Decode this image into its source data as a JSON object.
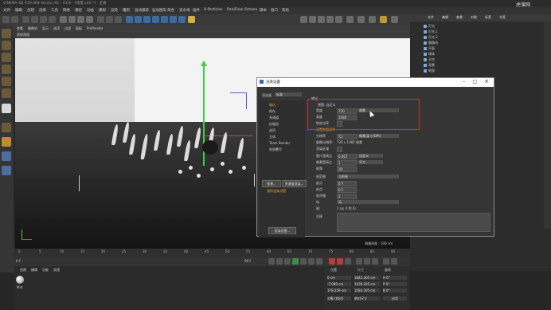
{
  "window": {
    "title": "CINEMA 4D R19.068 Studio (RC - R19) - [场景.c4d *] - 主要",
    "logo": "虎课网"
  },
  "menubar": [
    "文件",
    "编辑",
    "创建",
    "选择",
    "工具",
    "网格",
    "捕捉",
    "动画",
    "模拟",
    "渲染",
    "雕刻",
    "运动跟踪",
    "运动图形",
    "角色",
    "流水线",
    "插件",
    "X-Particles",
    "RealFlow",
    "Octane",
    "脚本",
    "窗口",
    "帮助"
  ],
  "viewport": {
    "menu": [
      "查看",
      "摄像机",
      "显示",
      "选项",
      "过滤",
      "面板",
      "ProRender"
    ],
    "label": "透视视图",
    "grid_spacing": "网格间距 : 100 cm"
  },
  "right_panel": {
    "tabs": [
      "文件",
      "编辑",
      "查看",
      "对象",
      "标签",
      "书签"
    ],
    "objects": [
      "灯光",
      "灯光.1",
      "灯光.2",
      "摄像机",
      "平面",
      "球体",
      "天空",
      "背景",
      "地面"
    ]
  },
  "timeline": {
    "ticks": [
      "0",
      "5",
      "10",
      "15",
      "20",
      "25",
      "30",
      "35",
      "40",
      "45",
      "50",
      "55",
      "60",
      "65",
      "70",
      "75",
      "80",
      "85",
      "90"
    ],
    "frame": "0 F",
    "end": "90 F"
  },
  "materials": {
    "tabs": [
      "创建",
      "编辑",
      "功能",
      "纹理"
    ],
    "item": "Mat"
  },
  "coords": {
    "headers": [
      "位置",
      "尺寸",
      "旋转"
    ],
    "rows": [
      {
        "pos": "0 cm",
        "size": "1841.205 cm",
        "rot": "H 0°"
      },
      {
        "pos": "-7.089 cm",
        "size": "1636.245 cm",
        "rot": "P 0°"
      },
      {
        "pos": "178.259 cm",
        "size": "1583.305 cm",
        "rot": "B 0°"
      }
    ],
    "buttons": [
      "对象 (相对)",
      "绝对尺寸",
      "应用"
    ]
  },
  "dialog": {
    "title": "渲染设置",
    "renderer_label": "渲染器",
    "renderer_value": "标准",
    "nav": [
      "输出",
      "保存",
      "多通道",
      "抗锯齿",
      "选项",
      "立体",
      "Team Render",
      "材质覆写"
    ],
    "nav_selected": "输出",
    "effect_button": "效果...",
    "multi_button": "多通道渲染...",
    "my_settings": "我的渲染设置",
    "render_settings_button": "渲染设置...",
    "section": "输出",
    "preset_label": "预置: 自定义",
    "fields": [
      {
        "label": "宽度",
        "value": "720",
        "unit": "像素"
      },
      {
        "label": "高度",
        "value": "1080",
        "unit": ""
      },
      {
        "label": "锁定比率",
        "value": "",
        "unit": ""
      },
      {
        "label": "调整数据速率",
        "value": "",
        "unit": ""
      },
      {
        "label": "分辨率",
        "value": "72",
        "unit": "像素/英寸(DPI)"
      },
      {
        "label": "图像分辨率:",
        "value": "720 x 1080 像素",
        "unit": ""
      },
      {
        "label": "渲染区域",
        "value": "",
        "unit": ""
      },
      {
        "label": "胶片宽高比",
        "value": "0.667",
        "unit": "自定义"
      },
      {
        "label": "像素宽高比",
        "value": "1",
        "unit": "平方"
      },
      {
        "label": "帧频",
        "value": "30",
        "unit": ""
      },
      {
        "label": "帧范围",
        "value": "当前帧",
        "unit": ""
      },
      {
        "label": "起点",
        "value": "0 F",
        "unit": ""
      },
      {
        "label": "终点",
        "value": "0 F",
        "unit": ""
      },
      {
        "label": "帧步幅",
        "value": "1",
        "unit": ""
      },
      {
        "label": "场",
        "value": "无",
        "unit": ""
      },
      {
        "label": "帧:",
        "value": "1 (从 0 到 0)",
        "unit": ""
      },
      {
        "label": "注释",
        "value": "",
        "unit": ""
      }
    ]
  }
}
